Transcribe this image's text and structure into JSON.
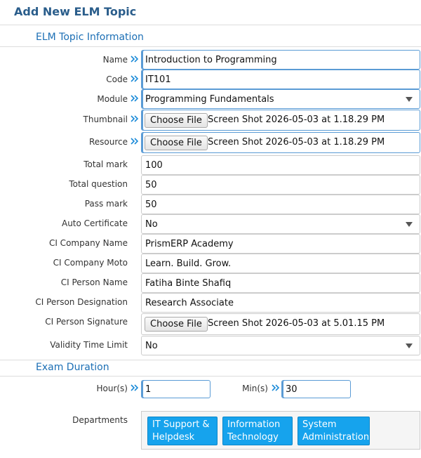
{
  "page": {
    "title": "Add New ELM Topic"
  },
  "sections": {
    "topic_info": "ELM Topic Information",
    "exam_duration": "Exam Duration"
  },
  "fields": {
    "name": {
      "label": "Name",
      "value": "Introduction to Programming"
    },
    "code": {
      "label": "Code",
      "value": "IT101"
    },
    "module": {
      "label": "Module",
      "value": "Programming Fundamentals"
    },
    "thumbnail": {
      "label": "Thumbnail",
      "button": "Choose File",
      "file": "Screen Shot 2026-05-03 at 1.18.29 PM"
    },
    "resource": {
      "label": "Resource",
      "button": "Choose File",
      "file": "Screen Shot 2026-05-03 at 1.18.29 PM"
    },
    "total_mark": {
      "label": "Total mark",
      "value": "100"
    },
    "total_question": {
      "label": "Total question",
      "value": "50"
    },
    "pass_mark": {
      "label": "Pass mark",
      "value": "50"
    },
    "auto_certificate": {
      "label": "Auto Certificate",
      "value": "No"
    },
    "ci_company_name": {
      "label": "CI Company Name",
      "value": "PrismERP Academy"
    },
    "ci_company_moto": {
      "label": "CI Company Moto",
      "value": "Learn. Build. Grow."
    },
    "ci_person_name": {
      "label": "CI Person Name",
      "value": "Fatiha Binte Shafiq"
    },
    "ci_person_designation": {
      "label": "CI Person Designation",
      "value": "Research Associate"
    },
    "ci_person_signature": {
      "label": "CI Person Signature",
      "button": "Choose File",
      "file": "Screen Shot 2026-05-03 at 5.01.15 PM"
    },
    "validity_time_limit": {
      "label": "Validity Time Limit",
      "value": "No"
    }
  },
  "duration": {
    "hours": {
      "label": "Hour(s)",
      "value": "1"
    },
    "mins": {
      "label": "Min(s)",
      "value": "30"
    }
  },
  "departments": {
    "label": "Departments",
    "items": [
      {
        "line1": "IT Support &",
        "line2": "Helpdesk"
      },
      {
        "line1": "Information",
        "line2": "Technology"
      },
      {
        "line1": "System",
        "line2": "Administration"
      }
    ]
  },
  "colors": {
    "accent": "#1c6fb5",
    "title": "#2a5d8b",
    "department_chip": "#16a3ed",
    "required_icon": "#1a8ad8"
  },
  "icons": {
    "required": "double-chevron-right-icon",
    "dropdown": "caret-down-icon"
  }
}
